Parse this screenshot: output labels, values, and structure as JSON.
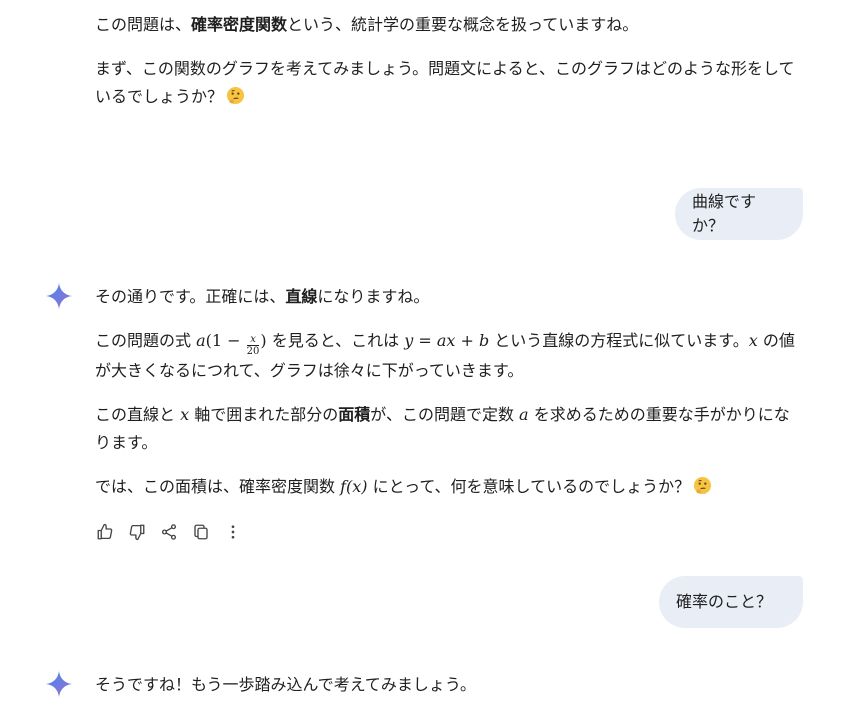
{
  "msg1": {
    "line1_pre": "この問題は、",
    "line1_bold": "確率密度関数",
    "line1_post": "という、統計学の重要な概念を扱っていますね。",
    "line2": "まず、この関数のグラフを考えてみましょう。問題文によると、このグラフはどのような形をしているでしょうか？"
  },
  "user1": {
    "text": "曲線ですか？"
  },
  "msg2": {
    "p1_pre": "その通りです。正確には、",
    "p1_bold": "直線",
    "p1_post": "になりますね。",
    "p2_pre": "この問題の式",
    "formula_a": "a",
    "formula_open": "(1 − ",
    "frac_num": "x",
    "frac_den": "20",
    "formula_close": ")",
    "p2_mid": "を見ると、これは",
    "linear_eq": "y = ax + b",
    "p2_mid2": "という直線の方程式に似ています。",
    "var_x": "x",
    "p2_post": "の値が大きくなるにつれて、グラフは徐々に下がっていきます。",
    "p3_pre": "この直線と",
    "var_x2": "x",
    "p3_mid": "軸で囲まれた部分の",
    "p3_bold": "面積",
    "p3_mid2": "が、この問題で定数",
    "var_a": "a",
    "p3_post": "を求めるための重要な手がかりになります。",
    "p4_pre": "では、この面積は、確率密度関数",
    "func_fx": "f(x)",
    "p4_post": "にとって、何を意味しているのでしょうか？"
  },
  "actions": {
    "icons": [
      "thumbs-up-icon",
      "thumbs-down-icon",
      "share-icon",
      "copy-icon",
      "more-vert-icon"
    ]
  },
  "user2": {
    "text": "確率のこと？"
  },
  "msg3": {
    "text": "そうですね！もう一歩踏み込んで考えてみましょう。"
  },
  "colors": {
    "bubble": "#e9eef6",
    "spark_start": "#4285f4",
    "spark_end": "#9b72cb",
    "text": "#1f1f1f"
  }
}
